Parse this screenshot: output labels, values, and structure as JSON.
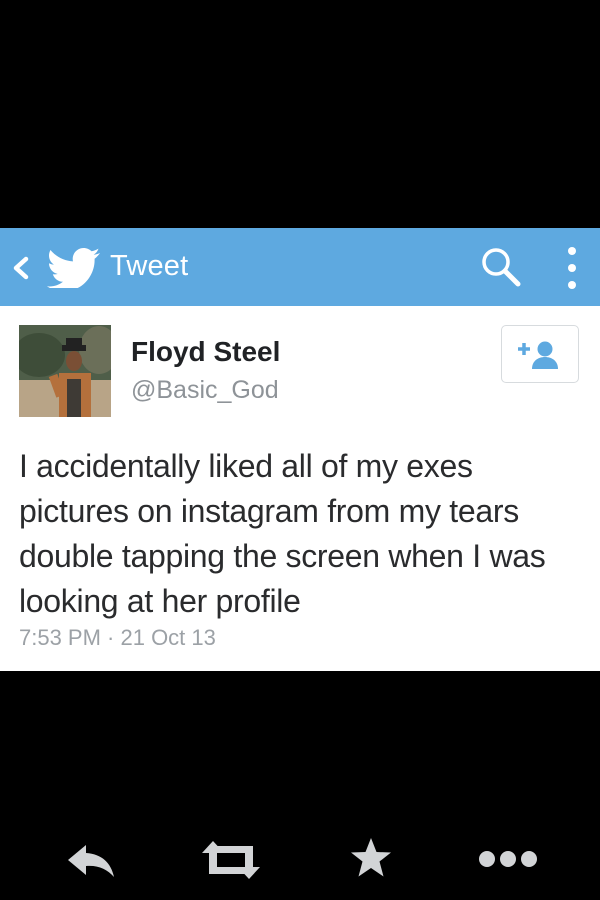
{
  "topbar": {
    "title": "Tweet",
    "background": "#5ea9e0",
    "icons": [
      "chevron-left-icon",
      "twitter-bird-icon",
      "search-icon",
      "more-vertical-icon"
    ]
  },
  "tweet": {
    "author_name": "Floyd Steel",
    "author_handle": "@Basic_God",
    "text": "I accidentally liked all of my exes pictures on instagram from my tears double tapping the screen when I was looking at her profile",
    "timestamp": "7:53 PM · 21 Oct 13",
    "follow_icon": "add-user-icon",
    "follow_color": "#5ea9e0"
  },
  "actions": {
    "icons": [
      "reply-icon",
      "retweet-icon",
      "favorite-icon",
      "more-horizontal-icon"
    ],
    "color": "#d2d4d6"
  }
}
